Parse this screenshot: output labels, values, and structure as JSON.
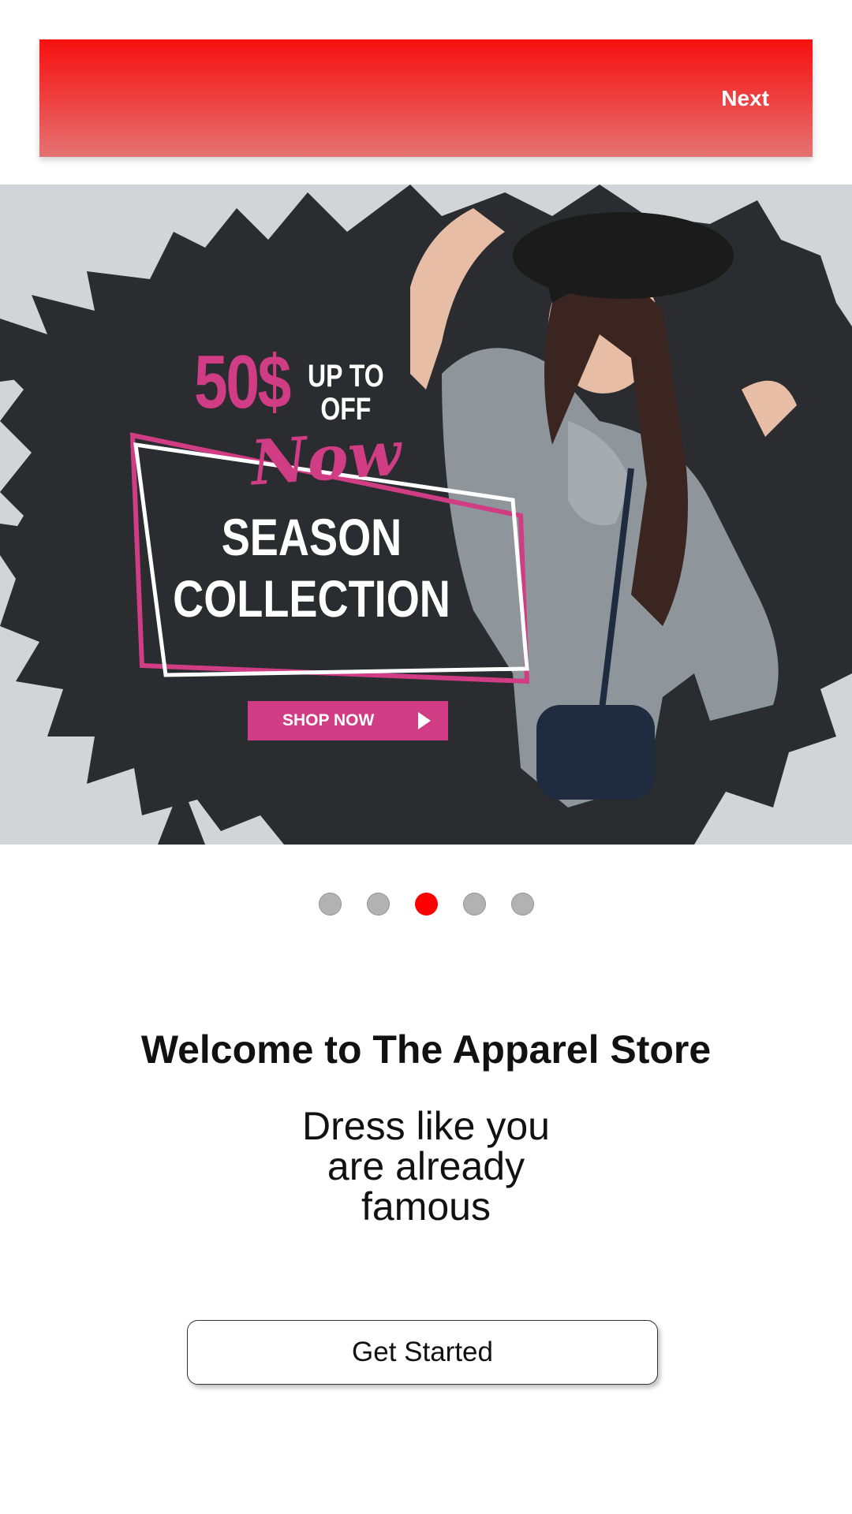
{
  "header": {
    "next_label": "Next"
  },
  "banner": {
    "price": "50$",
    "up_to": "UP TO",
    "off": "OFF",
    "now": "Now",
    "season": "SEASON",
    "collection": "COLLECTION",
    "shop_now": "SHOP NOW"
  },
  "carousel": {
    "total": 5,
    "active_index": 2
  },
  "content": {
    "title": "Welcome to The Apparel Store",
    "tagline_line1": "Dress like you",
    "tagline_line2": "are already",
    "tagline_line3": "famous"
  },
  "cta": {
    "get_started_label": "Get Started"
  },
  "colors": {
    "accent": "#ff0000",
    "promo_pink": "#d13d84",
    "banner_bg": "#d3d4d8",
    "brush_dark": "#2a2c30"
  },
  "icons": {
    "play": "play-icon"
  }
}
